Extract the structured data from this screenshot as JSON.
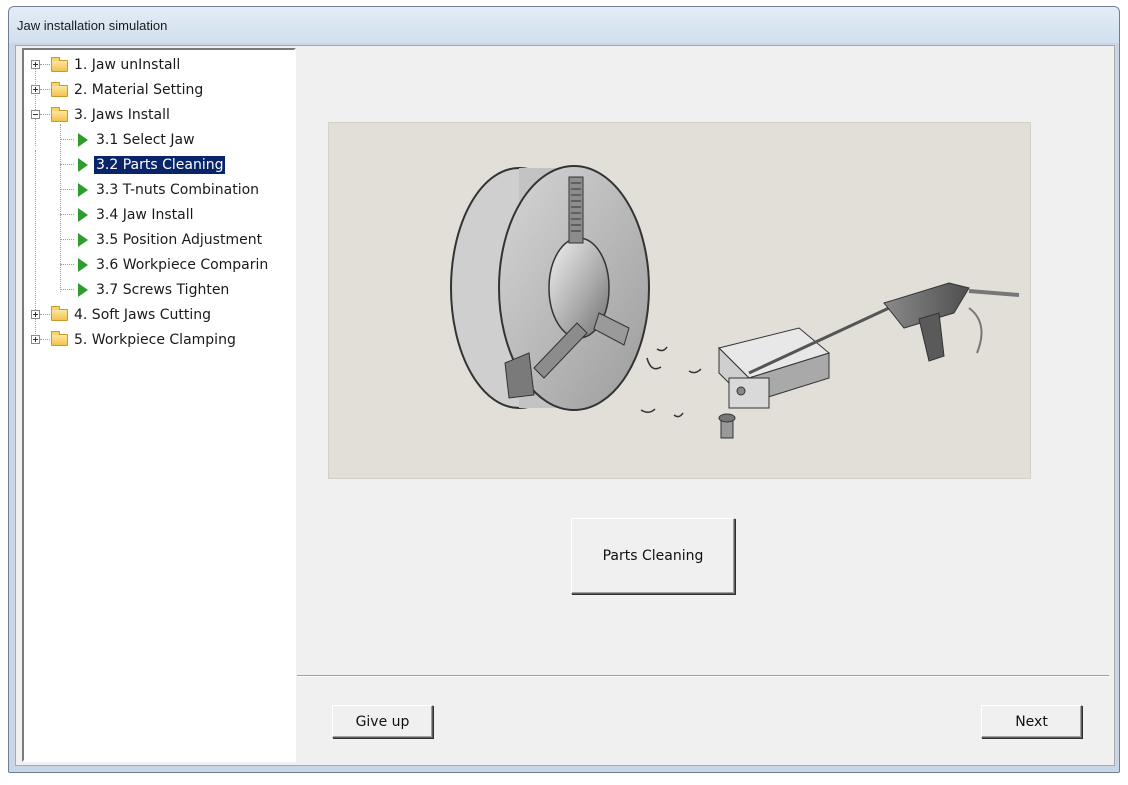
{
  "window": {
    "title": "Jaw installation simulation"
  },
  "tree": {
    "items": [
      {
        "label": "1. Jaw unInstall",
        "type": "folder",
        "expanded": false,
        "icon": "folder-open-icon"
      },
      {
        "label": "2. Material Setting",
        "type": "folder",
        "expanded": false,
        "icon": "folder-open-icon"
      },
      {
        "label": "3. Jaws Install",
        "type": "folder",
        "expanded": true,
        "icon": "folder-open-icon",
        "children": [
          {
            "label": "3.1 Select Jaw",
            "icon": "play-icon",
            "selected": false
          },
          {
            "label": "3.2 Parts Cleaning",
            "icon": "play-icon",
            "selected": true
          },
          {
            "label": "3.3 T-nuts Combination",
            "icon": "play-icon",
            "selected": false
          },
          {
            "label": "3.4 Jaw Install",
            "icon": "play-icon",
            "selected": false
          },
          {
            "label": "3.5 Position Adjustment",
            "icon": "play-icon",
            "selected": false
          },
          {
            "label": "3.6 Workpiece Comparin",
            "icon": "play-icon",
            "selected": false
          },
          {
            "label": "3.7 Screws Tighten",
            "icon": "play-icon",
            "selected": false
          }
        ]
      },
      {
        "label": "4. Soft Jaws Cutting",
        "type": "folder",
        "expanded": false,
        "icon": "folder-closed-icon"
      },
      {
        "label": "5. Workpiece Clamping",
        "type": "folder",
        "expanded": false,
        "icon": "folder-closed-icon"
      }
    ]
  },
  "main": {
    "step_button_label": "Parts Cleaning"
  },
  "footer": {
    "give_up_label": "Give up",
    "next_label": "Next"
  },
  "colors": {
    "selection": "#0a246a",
    "play_icon": "#2e9d2e",
    "image_background": "#e2dfd8"
  }
}
